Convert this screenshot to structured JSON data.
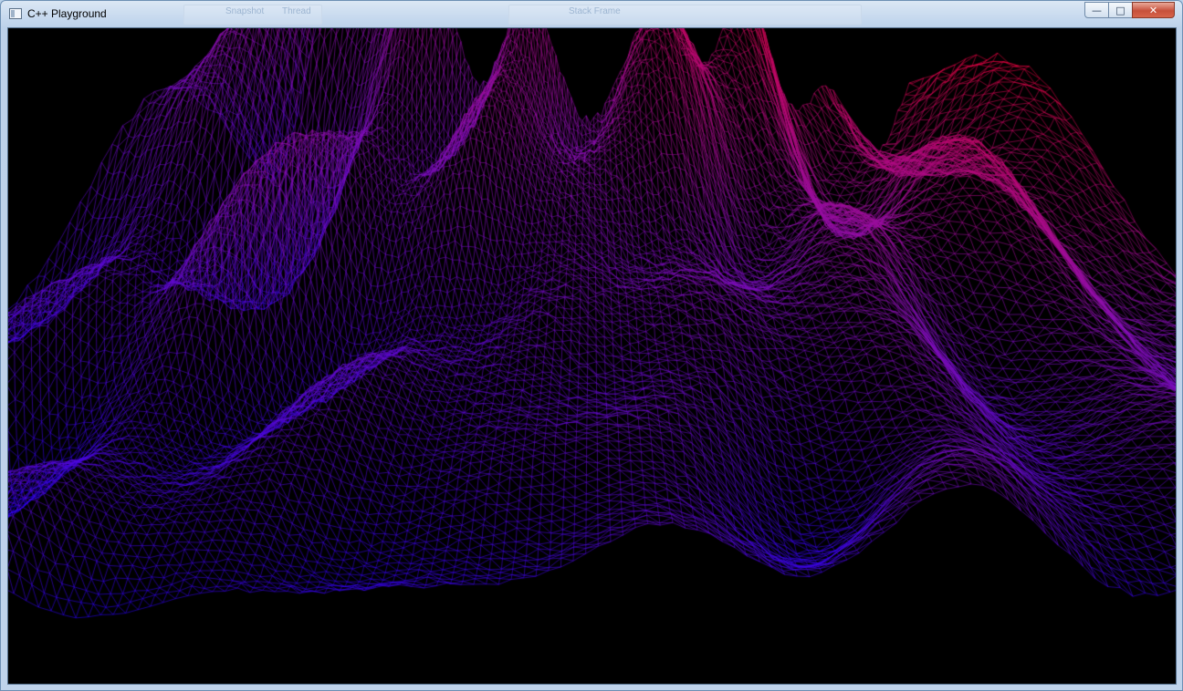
{
  "window": {
    "title": "C++ Playground",
    "app_icon": "window-app-icon",
    "controls": {
      "minimize_glyph": "—",
      "maximize_glyph": "□",
      "close_glyph": "✕"
    },
    "background_toolbar_ghost": {
      "item1": "Snapshot",
      "item2": "Thread",
      "item3": "Stack Frame"
    }
  },
  "viewport": {
    "content": "wireframe-terrain",
    "background_color": "#000000",
    "color_gradient": {
      "low": "#1400ff",
      "mid": "#8a10b4",
      "high": "#ff0018"
    }
  }
}
